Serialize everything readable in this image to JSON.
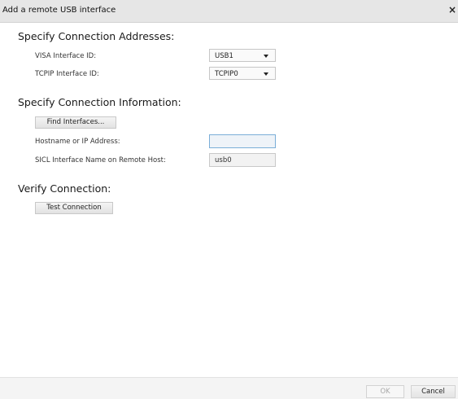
{
  "dialog": {
    "title": "Add a remote USB interface",
    "close_glyph": "×"
  },
  "addresses": {
    "heading": "Specify Connection Addresses:",
    "visa_label": "VISA Interface ID:",
    "visa_value": "USB1",
    "tcpip_label": "TCPIP Interface ID:",
    "tcpip_value": "TCPIP0"
  },
  "info": {
    "heading": "Specify Connection Information:",
    "find_button": "Find Interfaces...",
    "hostname_label": "Hostname or IP Address:",
    "hostname_value": "",
    "sicl_label": "SICL Interface Name on Remote Host:",
    "sicl_value": "usb0"
  },
  "verify": {
    "heading": "Verify Connection:",
    "test_button": "Test Connection"
  },
  "footer": {
    "ok_label": "OK",
    "cancel_label": "Cancel"
  }
}
